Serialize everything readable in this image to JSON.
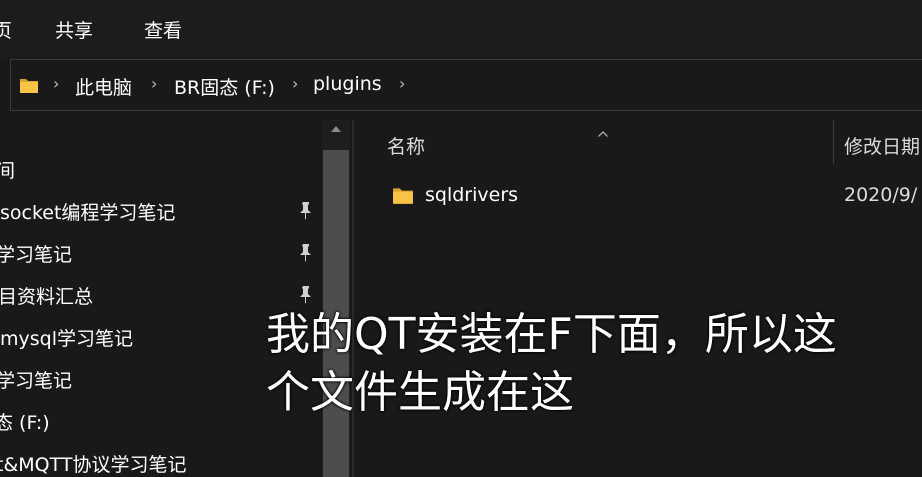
{
  "menubar": {
    "items": [
      "页",
      "共享",
      "查看"
    ]
  },
  "address": {
    "crumbs": [
      "此电脑",
      "BR固态 (F:)",
      "plugins"
    ],
    "separator": "›",
    "folder_icon": "folder-icon"
  },
  "nav": {
    "items": [
      {
        "label": "间",
        "pinned": false
      },
      {
        "label": "socket编程学习笔记",
        "pinned": true
      },
      {
        "label": "学习笔记",
        "pinned": true
      },
      {
        "label": "目资料汇总",
        "pinned": true
      },
      {
        "label": "mysql学习笔记",
        "pinned": false
      },
      {
        "label": "学习笔记",
        "pinned": false
      },
      {
        "label": "态 (F:)",
        "pinned": false
      },
      {
        "label": "t&MQTT协议学习笔记",
        "pinned": false
      }
    ],
    "pin_icon": "pin-icon"
  },
  "files": {
    "columns": {
      "name": "名称",
      "modified": "修改日期"
    },
    "rows": [
      {
        "name": "sqldrivers",
        "modified": "2020/9/",
        "icon": "folder-icon"
      }
    ]
  },
  "caption": {
    "line1": "我的QT安装在F下面，所以这",
    "line2": "个文件生成在这"
  },
  "colors": {
    "background": "#191919",
    "folder_yellow": "#f8c446",
    "text": "#ffffff"
  }
}
